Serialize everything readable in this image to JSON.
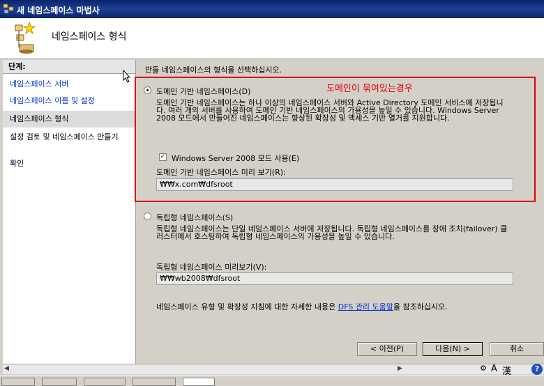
{
  "window": {
    "title": "새 네임스페이스 마법사"
  },
  "header": {
    "title": "네임스페이스 형식"
  },
  "sidebar": {
    "header": "단계:",
    "items": [
      {
        "label": "네임스페이스 서버",
        "state": "link"
      },
      {
        "label": "네임스페이스 이름 및 설정",
        "state": "link"
      },
      {
        "label": "네임스페이스 형식",
        "state": "current"
      },
      {
        "label": "설정 검토 및 네임스페이스 만들기",
        "state": "plain"
      },
      {
        "label": "확인",
        "state": "plain"
      }
    ]
  },
  "main": {
    "intro": "만들 네임스페이스의 형식을 선택하십시오.",
    "annotation": "도메인이 묶여있는경우",
    "domain_option": {
      "label": "도메인 기반 네임스페이스(D)",
      "selected": true,
      "description": "도메인 기반 네임스페이스는 하나 이상의 네임스페이스 서버와 Active Directory 도메인 서비스에 저장됩니다. 여러 개의 서버를 사용하여 도메인 기반 네임스페이스의 가용성을 높일 수 있습니다. Windows Server 2008 모드에서 만들어진 네임스페이스는 향상된 확장성 및 액세스 기반 열거를 지원합니다.",
      "mode_checkbox_label": "Windows Server 2008 모드 사용(E)",
      "mode_checked": true,
      "preview_label": "도메인 기반 네임스페이스 미리 보기(R):",
      "preview_value": "₩₩x.com₩dfsroot"
    },
    "standalone_option": {
      "label": "독립형 네임스페이스(S)",
      "selected": false,
      "description": "독립형 네임스페이스는 단일 네임스페이스 서버에 저장됩니다. 독립형 네임스페이스를 장애 조치(failover) 클러스터에서 호스팅하여 독립형 네임스페이스의 가용성을 높일 수 있습니다.",
      "preview_label": "독립형 네임스페이스 미리보기(V):",
      "preview_value": "₩₩wb2008₩dfsroot"
    },
    "help_prefix": "네임스페이스 유형 및 확장성 지침에 대한 자세한 내용은 ",
    "help_link": "DFS 관리 도움말",
    "help_suffix": "을 참조하십시오."
  },
  "buttons": {
    "back": "< 이전(P)",
    "next": "다음(N) >",
    "cancel": "취소"
  },
  "ime": {
    "mode": "A",
    "hanja": "漢",
    "help": "?"
  },
  "colors": {
    "titlebar": "#0a246a",
    "link": "#0033cc",
    "annotation": "#e00000"
  }
}
